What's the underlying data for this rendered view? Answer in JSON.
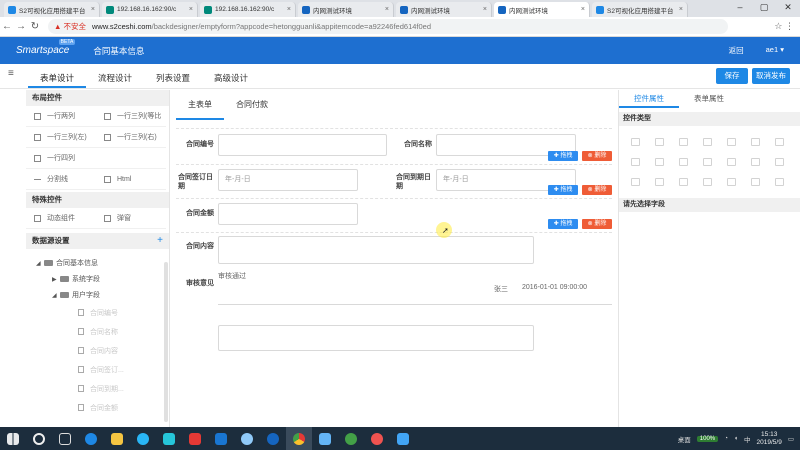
{
  "browser": {
    "tabs": [
      {
        "title": "S2可视化应用搭建平台",
        "fav": "#1e88e5",
        "active": false
      },
      {
        "title": "192.168.16.162:90/c",
        "fav": "#00897b",
        "active": false
      },
      {
        "title": "192.168.16.162:90/c",
        "fav": "#00897b",
        "active": false
      },
      {
        "title": "内网测试环境",
        "fav": "#1565c0",
        "active": false
      },
      {
        "title": "内网测试环境",
        "fav": "#1565c0",
        "active": false
      },
      {
        "title": "内网测试环境",
        "fav": "#1565c0",
        "active": true
      },
      {
        "title": "S2可视化应用搭建平台",
        "fav": "#1e88e5",
        "active": false
      }
    ],
    "insecure_label": "▲ 不安全",
    "url_host": "www.s2ceshi.com",
    "url_path": "/backdesigner/emptyform?appcode=hetongguanli&appitemcode=a92246fed614f0ed"
  },
  "app": {
    "logo": "Smartspace",
    "logo_badge": "BETA",
    "title": "合同基本信息",
    "back": "返回",
    "user": "ae1 ▾"
  },
  "toptabs": [
    "表单设计",
    "流程设计",
    "列表设置",
    "高级设计"
  ],
  "buttons": {
    "save": "保存",
    "unpublish": "取消发布"
  },
  "left": {
    "layout_title": "布局控件",
    "layout_items": [
      "一行两列",
      "一行三列(等比",
      "一行三列(左)",
      "一行三列(右)",
      "一行四列",
      "",
      "分割线",
      "Html"
    ],
    "special_title": "特殊控件",
    "special_items": [
      "动态组件",
      "弹窗"
    ],
    "datasource_title": "数据源设置",
    "add": "+",
    "tree": {
      "root": "合同基本信息",
      "system": "系统字段",
      "user": "用户字段",
      "fields": [
        "合同编号",
        "合同名称",
        "合同内容",
        "合同签订...",
        "合同到期...",
        "合同金额"
      ]
    }
  },
  "center": {
    "tabs": [
      "主表单",
      "合同付款"
    ],
    "fields": {
      "number": "合同编号",
      "name": "合同名称",
      "sign_date": "合同签订日期",
      "due_date": "合同到期日期",
      "amount": "合同金额",
      "content": "合同内容",
      "review": "审核意见"
    },
    "date_placeholder": "年-月-日",
    "drag": "✚ 拖拽",
    "delete": "⊗ 删除",
    "review_status": "审核通过",
    "reviewer": "张三",
    "review_time": "2016-01-01 09:00:00"
  },
  "right": {
    "tabs": [
      "控件属性",
      "表单属性"
    ],
    "control_type": "控件类型",
    "select_hint": "请先选择字段"
  },
  "taskbar": {
    "desktop": "桌面",
    "battery": "100%",
    "ime": "中",
    "time": "15:13",
    "date": "2019/5/9"
  }
}
